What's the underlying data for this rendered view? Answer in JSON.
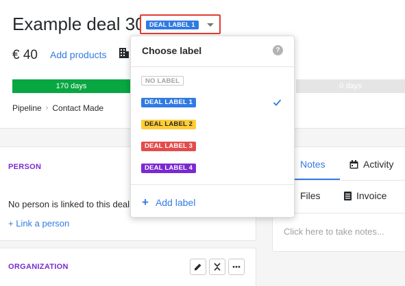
{
  "deal": {
    "title": "Example deal 30",
    "selected_label": "DEAL LABEL 1",
    "amount": "€ 40",
    "add_products": "Add products",
    "stages": [
      {
        "label": "170 days",
        "color": "#08a742"
      },
      {
        "label": "0 days",
        "color": "#e5e5e5"
      }
    ],
    "breadcrumb": [
      "Pipeline",
      "Contact Made"
    ]
  },
  "person": {
    "title": "PERSON",
    "empty_text": "No person is linked to this deal.",
    "link_text": "+ Link a person"
  },
  "organization": {
    "title": "ORGANIZATION"
  },
  "panel": {
    "tabs": [
      {
        "label": "Notes",
        "icon": "notes-icon",
        "active": true
      },
      {
        "label": "Activity",
        "icon": "calendar-icon"
      },
      {
        "label": "Files",
        "icon": "files-icon"
      },
      {
        "label": "Invoice",
        "icon": "invoice-icon"
      }
    ],
    "notes_placeholder": "Click here to take notes..."
  },
  "label_dropdown": {
    "title": "Choose label",
    "help": "?",
    "options": [
      {
        "label": "NO LABEL",
        "bg": "#ffffff",
        "fg": "#a0a1a3",
        "border": "#c8c8c8",
        "selected": false
      },
      {
        "label": "DEAL LABEL 1",
        "bg": "#317ae2",
        "fg": "#ffffff",
        "selected": true
      },
      {
        "label": "DEAL LABEL 2",
        "bg": "#ffcc33",
        "fg": "#26292c",
        "selected": false
      },
      {
        "label": "DEAL LABEL 3",
        "bg": "#e34c4c",
        "fg": "#ffffff",
        "selected": false
      },
      {
        "label": "DEAL LABEL 4",
        "bg": "#7a2ad1",
        "fg": "#ffffff",
        "selected": false
      }
    ],
    "add_label": "Add label",
    "add_icon": "+"
  }
}
